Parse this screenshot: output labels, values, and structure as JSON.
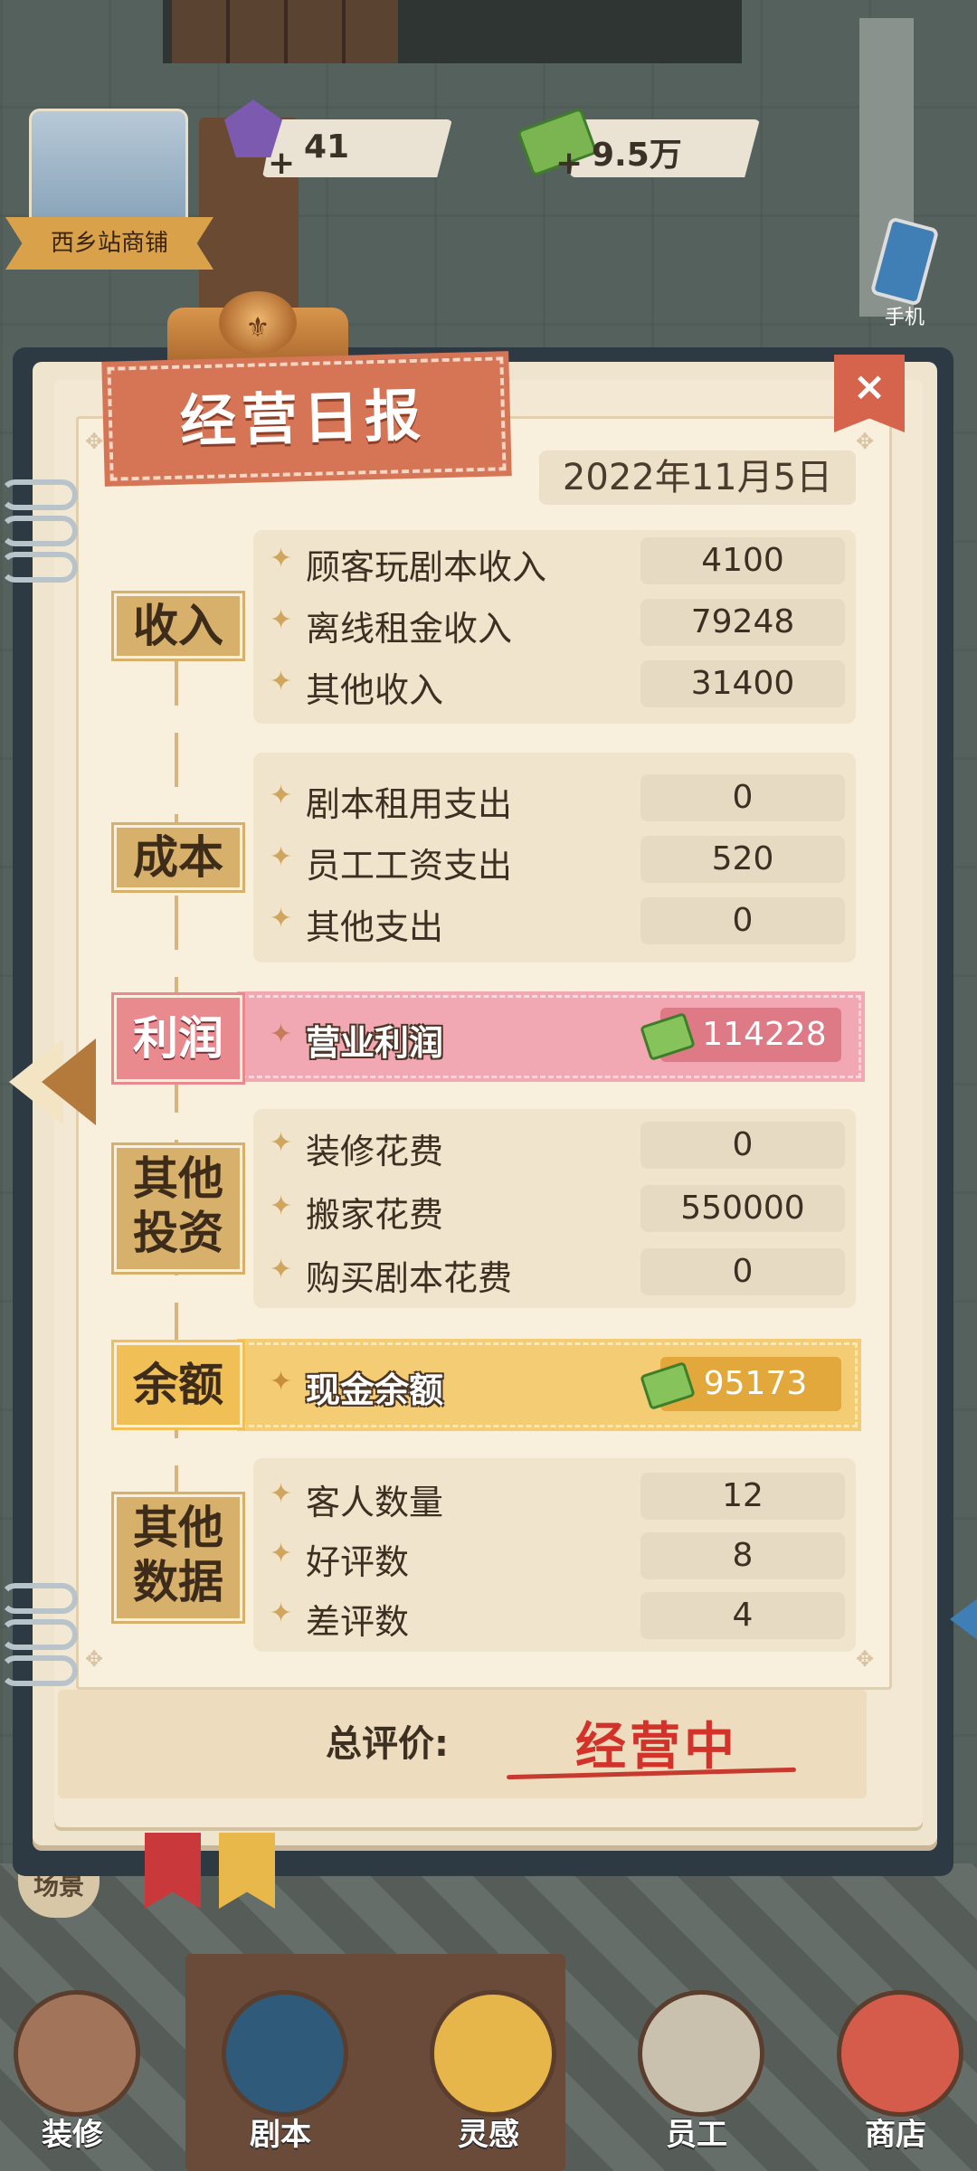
{
  "hud": {
    "shop_name": "西乡站商铺",
    "gems": "41",
    "cash": "9.5万",
    "plus": "+",
    "phone_label": "手机"
  },
  "report": {
    "title": "经营日报",
    "close_symbol": "×",
    "date": "2022年11月5日",
    "income": {
      "label": "收入",
      "rows": [
        {
          "label": "顾客玩剧本收入",
          "value": "4100"
        },
        {
          "label": "离线租金收入",
          "value": "79248"
        },
        {
          "label": "其他收入",
          "value": "31400"
        }
      ]
    },
    "cost": {
      "label": "成本",
      "rows": [
        {
          "label": "剧本租用支出",
          "value": "0"
        },
        {
          "label": "员工工资支出",
          "value": "520"
        },
        {
          "label": "其他支出",
          "value": "0"
        }
      ]
    },
    "profit": {
      "label": "利润",
      "item_label": "营业利润",
      "value": "114228"
    },
    "investment": {
      "label_line1": "其他",
      "label_line2": "投资",
      "rows": [
        {
          "label": "装修花费",
          "value": "0"
        },
        {
          "label": "搬家花费",
          "value": "550000"
        },
        {
          "label": "购买剧本花费",
          "value": "0"
        }
      ]
    },
    "balance": {
      "label": "余额",
      "item_label": "现金余额",
      "value": "95173"
    },
    "other_data": {
      "label_line1": "其他",
      "label_line2": "数据",
      "rows": [
        {
          "label": "客人数量",
          "value": "12"
        },
        {
          "label": "好评数",
          "value": "8"
        },
        {
          "label": "差评数",
          "value": "4"
        }
      ]
    },
    "rating_label": "总评价:",
    "rating_value": "经营中"
  },
  "bottom_nav": {
    "scene": "场景",
    "items": [
      "装修",
      "剧本",
      "灵感",
      "员工",
      "商店"
    ]
  },
  "colors": {
    "profit_highlight": "#f2a8b2",
    "balance_highlight": "#f3cc74",
    "title_banner": "#d67456",
    "rating_red": "#d3322b",
    "category_gold": "#d7b06c"
  }
}
